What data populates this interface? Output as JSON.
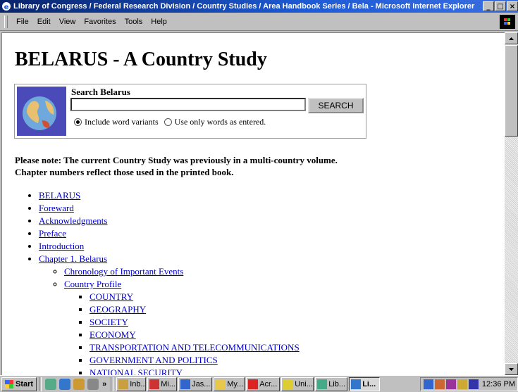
{
  "window": {
    "title": "Library of Congress / Federal Research Division / Country Studies / Area Handbook Series / Bela - Microsoft Internet Explorer",
    "btn_min": "_",
    "btn_max": "□",
    "btn_close": "×"
  },
  "menu": {
    "items": [
      {
        "label": "File"
      },
      {
        "label": "Edit"
      },
      {
        "label": "View"
      },
      {
        "label": "Favorites"
      },
      {
        "label": "Tools"
      },
      {
        "label": "Help"
      }
    ]
  },
  "page": {
    "title": "BELARUS - A Country Study",
    "search": {
      "label": "Search Belarus",
      "input_value": "",
      "button": "SEARCH",
      "option_variants": "Include word variants",
      "option_exact": "Use only words as entered.",
      "selected": "variants"
    },
    "note_line1": "Please note: The current Country Study was previously in a multi-country volume.",
    "note_line2": "Chapter numbers reflect those used in the printed book.",
    "toc": [
      {
        "label": "BELARUS"
      },
      {
        "label": "Foreward"
      },
      {
        "label": "Acknowledgments"
      },
      {
        "label": "Preface"
      },
      {
        "label": "Introduction"
      },
      {
        "label": "Chapter 1. Belarus"
      }
    ],
    "chapter1": [
      {
        "label": "Chronology of Important Events"
      },
      {
        "label": "Country Profile"
      }
    ],
    "profile": [
      {
        "label": "COUNTRY"
      },
      {
        "label": "GEOGRAPHY"
      },
      {
        "label": "SOCIETY"
      },
      {
        "label": "ECONOMY"
      },
      {
        "label": "TRANSPORTATION AND TELECOMMUNICATIONS"
      },
      {
        "label": "GOVERNMENT AND POLITICS"
      },
      {
        "label": "NATIONAL SECURITY"
      }
    ]
  },
  "taskbar": {
    "start": "Start",
    "chevron": "»",
    "tasks": [
      {
        "label": "Inb..."
      },
      {
        "label": "Mi..."
      },
      {
        "label": "Jas..."
      },
      {
        "label": "My..."
      },
      {
        "label": "Acr..."
      },
      {
        "label": "Uni..."
      },
      {
        "label": "Lib..."
      },
      {
        "label": "Li..."
      }
    ],
    "clock": "12:36 PM"
  },
  "colors": {
    "title_bar": "#08246b",
    "link": "#0000cc",
    "chrome": "#c0c0c0"
  }
}
